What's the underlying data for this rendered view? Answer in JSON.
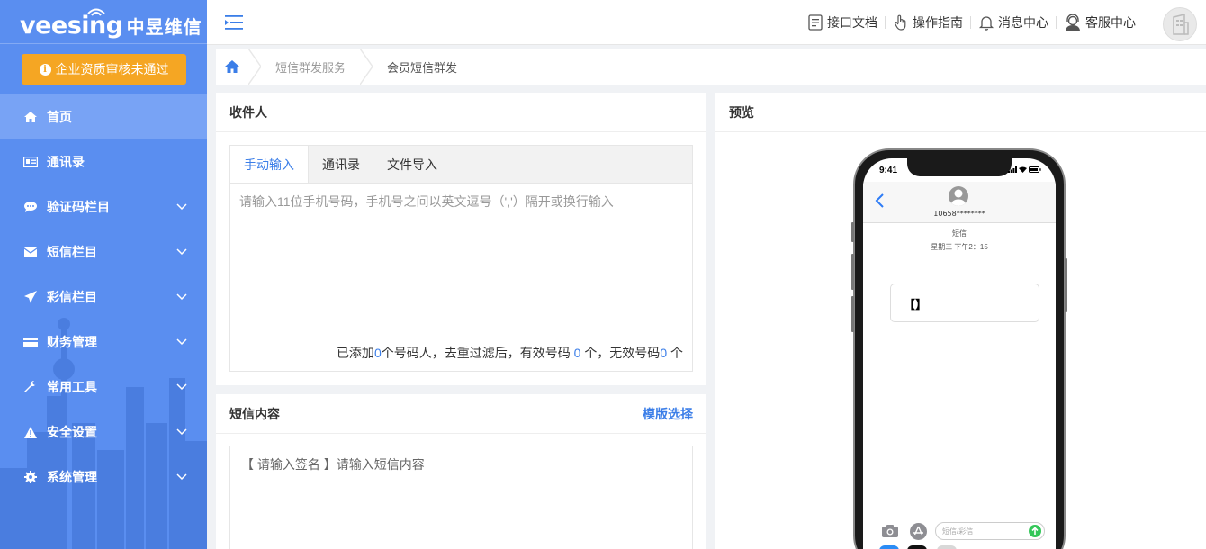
{
  "brand": {
    "logo_en": "veesing",
    "logo_cn": "中昱维信"
  },
  "sidebar": {
    "warning_button": "企业资质审核未通过",
    "items": [
      {
        "label": "首页",
        "icon": "home-icon",
        "active": true,
        "expandable": false
      },
      {
        "label": "通讯录",
        "icon": "address-card-icon",
        "active": false,
        "expandable": false
      },
      {
        "label": "验证码栏目",
        "icon": "comment-icon",
        "active": false,
        "expandable": true
      },
      {
        "label": "短信栏目",
        "icon": "envelope-icon",
        "active": false,
        "expandable": true
      },
      {
        "label": "彩信栏目",
        "icon": "paper-plane-icon",
        "active": false,
        "expandable": true
      },
      {
        "label": "财务管理",
        "icon": "credit-card-icon",
        "active": false,
        "expandable": true
      },
      {
        "label": "常用工具",
        "icon": "wrench-icon",
        "active": false,
        "expandable": true
      },
      {
        "label": "安全设置",
        "icon": "warning-icon",
        "active": false,
        "expandable": true
      },
      {
        "label": "系统管理",
        "icon": "gear-icon",
        "active": false,
        "expandable": true
      }
    ]
  },
  "topbar": {
    "api_docs": "接口文档",
    "guide": "操作指南",
    "messages": "消息中心",
    "support": "客服中心"
  },
  "breadcrumb": {
    "parent": "短信群发服务",
    "current": "会员短信群发"
  },
  "recipients": {
    "title": "收件人",
    "tabs": [
      "手动输入",
      "通讯录",
      "文件导入"
    ],
    "active_tab": 0,
    "placeholder": "请输入11位手机号码，手机号之间以英文逗号（','）隔开或换行输入",
    "count_prefix": "已添加",
    "added": "0",
    "count_mid": "个号码人，去重过滤后，有效号码",
    "valid": " 0 ",
    "count_mid2": "个，无效号码",
    "invalid": "0",
    "count_suffix": " 个"
  },
  "content": {
    "title": "短信内容",
    "template_link": "模版选择",
    "placeholder": "【 请输入签名 】请输入短信内容"
  },
  "preview": {
    "title": "预览",
    "time": "9:41",
    "contact": "10658********",
    "sms_label": "短信",
    "sms_time": "星期三 下午2：15",
    "bubble_text": "【】",
    "input_placeholder": "短信/彩信"
  },
  "colors": {
    "sidebar": "#5a8ef0",
    "accent": "#3b7ee8",
    "warning": "#f5a623"
  }
}
